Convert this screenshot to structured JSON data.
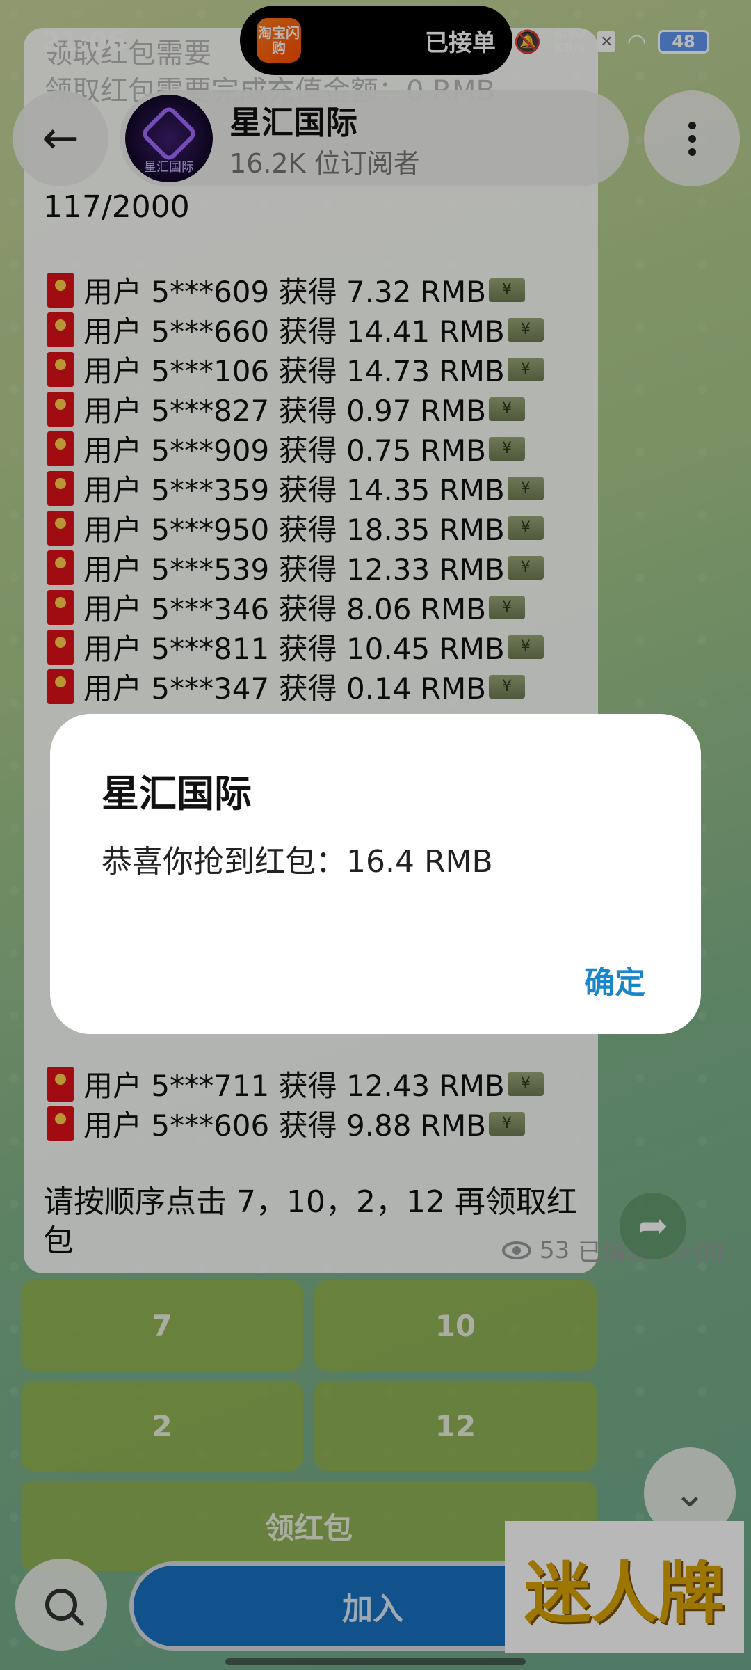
{
  "status_bar": {
    "time": "21:06",
    "island_app": "淘宝闪购",
    "island_text": "已接单",
    "net_speed_value": "6.90",
    "net_speed_unit": "KB/s",
    "battery": "48"
  },
  "header": {
    "channel_name": "星汇国际",
    "subscribers": "16.2K 位订阅者",
    "avatar_text": "星汇国际"
  },
  "message": {
    "ghost_line_1": "领取红包需要",
    "ghost_line_2": "领取红包需要完成充值金额：0 RMB",
    "count": "117/2000",
    "rows": [
      {
        "text": "用户 5***609 获得 7.32 RMB"
      },
      {
        "text": "用户 5***660 获得 14.41 RMB"
      },
      {
        "text": "用户 5***106 获得 14.73 RMB"
      },
      {
        "text": "用户 5***827 获得 0.97 RMB"
      },
      {
        "text": "用户 5***909 获得 0.75 RMB"
      },
      {
        "text": "用户 5***359 获得 14.35 RMB"
      },
      {
        "text": "用户 5***950 获得 18.35 RMB"
      },
      {
        "text": "用户 5***539 获得 12.33 RMB"
      },
      {
        "text": "用户 5***346 获得 8.06 RMB"
      },
      {
        "text": "用户 5***811 获得 10.45 RMB"
      },
      {
        "text": "用户 5***347 获得 0.14 RMB"
      }
    ],
    "tail_rows": [
      {
        "text": "用户 5***711 获得 12.43 RMB"
      },
      {
        "text": "用户 5***606 获得 9.88 RMB"
      }
    ],
    "instruction": "请按顺序点击 7，10，2，12 再领取红包",
    "views": "53",
    "edited": "已编辑 20:00"
  },
  "buttons": {
    "b7": "7",
    "b10": "10",
    "b2": "2",
    "b12": "12",
    "claim": "领红包",
    "join": "加入"
  },
  "dialog": {
    "title": "星汇国际",
    "message": "恭喜你抢到红包：16.4 RMB",
    "ok": "确定"
  },
  "watermark": "迷人牌",
  "colors": {
    "accent_blue": "#1a86c9",
    "join_blue": "#1a72c2",
    "envelope_red": "#e0101a"
  }
}
